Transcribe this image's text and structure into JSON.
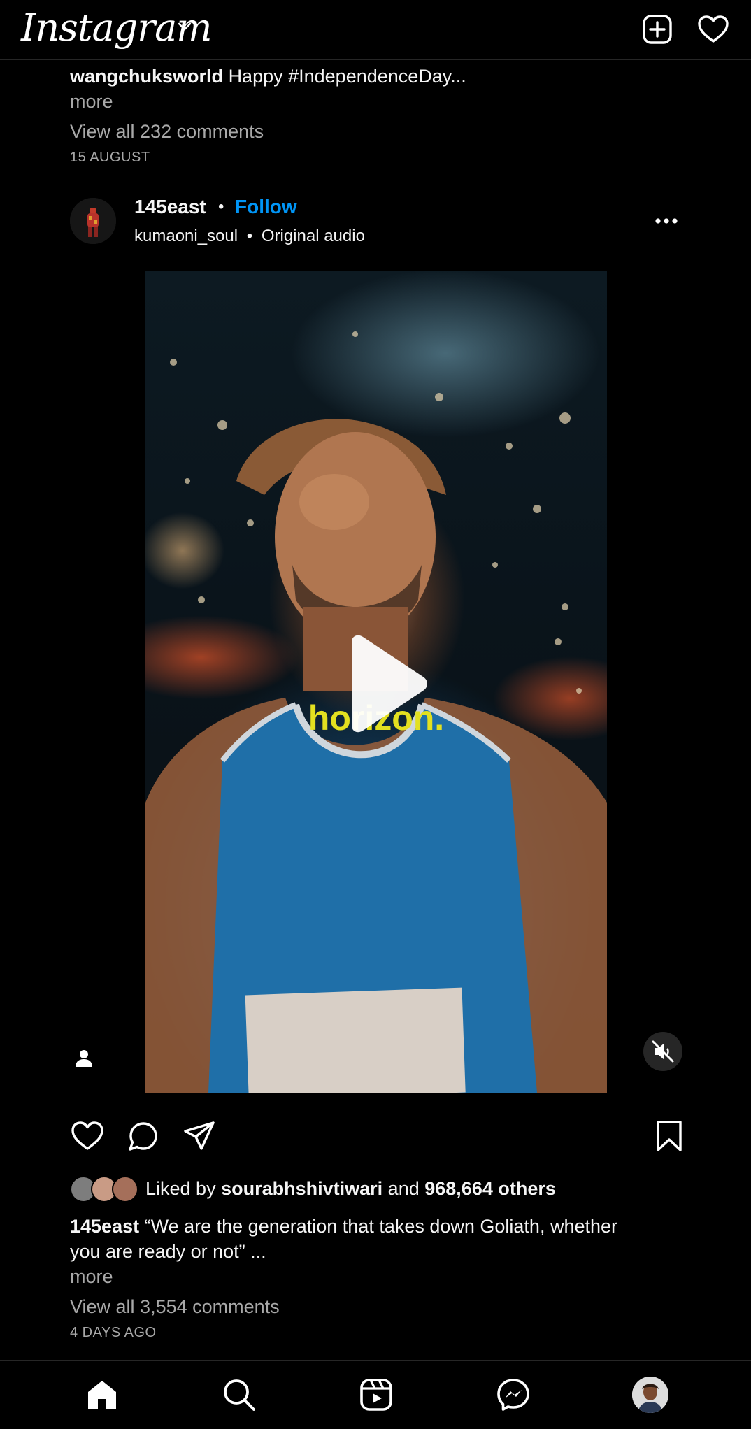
{
  "header": {
    "logo_text": "Instagram",
    "icons": [
      "chevron-down-icon",
      "new-post-icon",
      "heart-icon"
    ]
  },
  "prev_post": {
    "username": "wangchuksworld",
    "caption": "Happy #IndependenceDay...",
    "more_label": "more",
    "view_comments": "View all 232 comments",
    "date": "15 AUGUST"
  },
  "post": {
    "username": "145east",
    "separator": "•",
    "follow_label": "Follow",
    "audio_user": "kumaoni_soul",
    "audio_separator": "•",
    "audio_label": "Original audio",
    "overlay_text": "horizon.",
    "liked_by_prefix": "Liked by",
    "liked_by_user": "sourabhshivtiwari",
    "liked_by_and": "and",
    "liked_by_others": "968,664 others",
    "caption_username": "145east",
    "caption_line1": "“We are the generation that takes down Goliath, whether",
    "caption_line2": "you are ready or not” ...",
    "more_label": "more",
    "view_comments": "View all 3,554 comments",
    "date": "4 DAYS AGO"
  },
  "bottom_nav": {
    "items": [
      "home-icon",
      "search-icon",
      "reels-icon",
      "messenger-icon",
      "profile-avatar"
    ]
  },
  "colors": {
    "background": "#000000",
    "text": "#f5f5f5",
    "muted": "#a8a8a8",
    "follow_blue": "#0095f6",
    "overlay_yellow": "#e3e020"
  }
}
